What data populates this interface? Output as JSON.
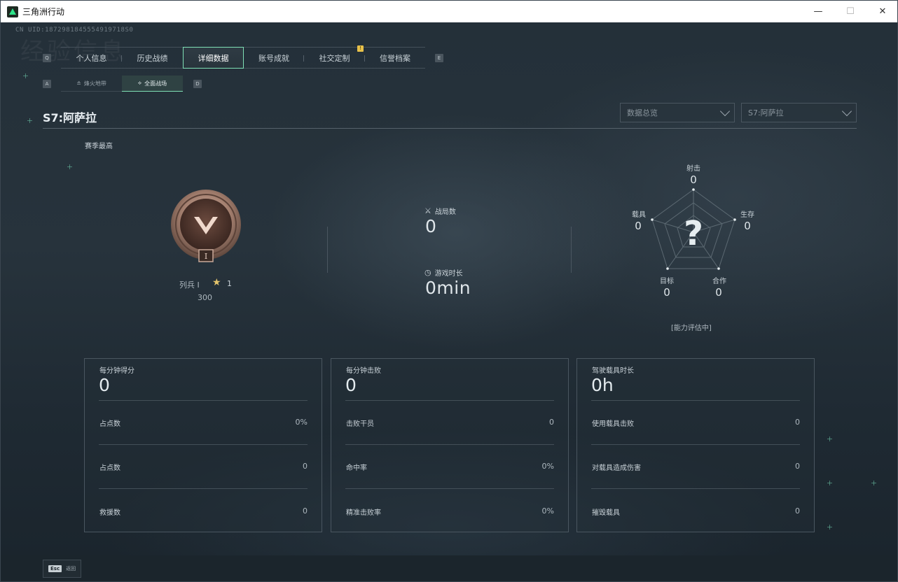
{
  "window": {
    "title": "三角洲行动",
    "min_glyph": "—",
    "max_glyph": "☐",
    "close_glyph": "✕"
  },
  "header": {
    "uid": "CN UID:1872981845554919718S0",
    "watermark": "经验信息"
  },
  "keys": {
    "prev_tab": "Q",
    "next_tab": "E",
    "prev_sub": "A",
    "next_sub": "D"
  },
  "main_tabs": [
    {
      "label": "个人信息"
    },
    {
      "label": "历史战绩"
    },
    {
      "label": "详细数据",
      "active": true
    },
    {
      "label": "账号成就"
    },
    {
      "label": "社交定制"
    },
    {
      "label": "信誉档案"
    }
  ],
  "tab_badge": "!",
  "sub_tabs": [
    {
      "label": "烽火地带",
      "icon": "flame-icon",
      "glyph": "≗"
    },
    {
      "label": "全面战场",
      "icon": "airborne-icon",
      "glyph": "⟡",
      "active": true
    }
  ],
  "season": {
    "title": "S7:阿萨拉",
    "best_label": "赛季最高"
  },
  "filters": {
    "scope": "数据总览",
    "season": "S7:阿萨拉"
  },
  "rank": {
    "name": "列兵 I",
    "stars": "1",
    "score": "300",
    "tier_numeral": "I"
  },
  "summary": {
    "matches_label": "战局数",
    "matches_value": "0",
    "playtime_label": "游戏时长",
    "playtime_value": "0min"
  },
  "radar": {
    "axes": [
      {
        "label": "射击",
        "value": "0"
      },
      {
        "label": "生存",
        "value": "0"
      },
      {
        "label": "合作",
        "value": "0"
      },
      {
        "label": "目标",
        "value": "0"
      },
      {
        "label": "载具",
        "value": "0"
      }
    ],
    "center_symbol": "?",
    "note": "[能力评估中]"
  },
  "cards": [
    {
      "title": "每分钟得分",
      "value": "0",
      "rows": [
        {
          "label": "占点数",
          "value": "0%"
        },
        {
          "label": "占点数",
          "value": "0"
        },
        {
          "label": "救援数",
          "value": "0"
        }
      ]
    },
    {
      "title": "每分钟击败",
      "value": "0",
      "rows": [
        {
          "label": "击败干员",
          "value": "0"
        },
        {
          "label": "命中率",
          "value": "0%"
        },
        {
          "label": "精准击败率",
          "value": "0%"
        }
      ]
    },
    {
      "title": "驾驶载具时长",
      "value": "0h",
      "rows": [
        {
          "label": "使用载具击败",
          "value": "0"
        },
        {
          "label": "对载具造成伤害",
          "value": "0"
        },
        {
          "label": "摧毁载具",
          "value": "0"
        }
      ]
    }
  ],
  "footer": {
    "esc_key": "Esc",
    "esc_label": "返回"
  }
}
